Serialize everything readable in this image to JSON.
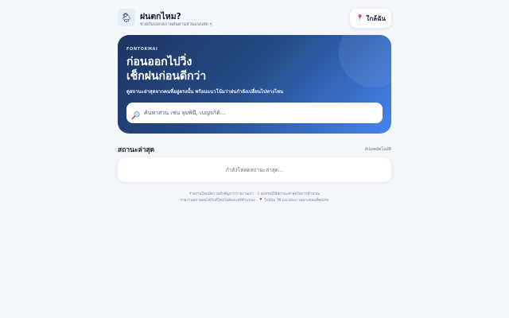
{
  "header": {
    "app_icon": "sun-behind-rain-cloud-icon",
    "app_icon_glyph": "🌦",
    "title": "ฝนตกไหม?",
    "subtitle": "ช่วยกันบอกสภาพฝนตามสวนแบบสด ๆ",
    "near_button_label": "ใกล้ฉัน",
    "near_button_icon": "📍"
  },
  "hero": {
    "brand": "FONTOKMAI",
    "title_line1": "ก่อนออกไปวิ่ง",
    "title_line2": "เช็กฝนก่อนดีกว่า",
    "description": "ดูสถานะล่าสุดจากคนที่อยู่ตรงนั้น พร้อมแนวโน้มว่าฝนกำลังเปลี่ยนไปทางไหน",
    "search_placeholder": "ค้นหาสวน เช่น ลุมพินี, เบญจกิติ...",
    "search_value": ""
  },
  "status": {
    "title": "สถานะล่าสุด",
    "auto_update": "อัปเดตอัตโนมัติ",
    "loading_text": "กำลังโหลดสถานะล่าสุด..."
  },
  "footer": {
    "line1": "รายงานใหม่มีความสำคัญกว่ารายงานเก่า · 1 อุปกรณ์ใช้สถานะล่าสุดในการคำนวณ",
    "line2": "รายงานสภาพฝนได้กับที่โดยไม่ต้องแชร์ตำแหน่ง · 📍 ใกล้ฉัน ใช้ Location เฉพาะตอนที่คุณกด"
  },
  "colors": {
    "background": "#f3f6fb",
    "hero_start": "#1c3460",
    "hero_end": "#4585f0",
    "pin": "#e0463b"
  }
}
